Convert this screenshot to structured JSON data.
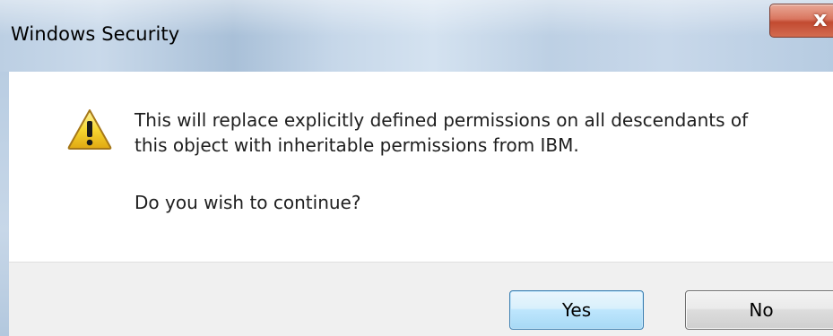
{
  "window": {
    "title": "Windows Security",
    "close_glyph": "x"
  },
  "dialog": {
    "icon": "warning-icon",
    "message_line1": "This will replace explicitly defined permissions on all descendants of",
    "message_line2": "this object with inheritable permissions from IBM.",
    "question": "Do you wish to continue?"
  },
  "buttons": {
    "yes_label": "Yes",
    "no_label": "No"
  },
  "colors": {
    "warning_fill": "#f7d731",
    "close_red": "#c24a31",
    "default_button_border": "#3c7fb1"
  }
}
